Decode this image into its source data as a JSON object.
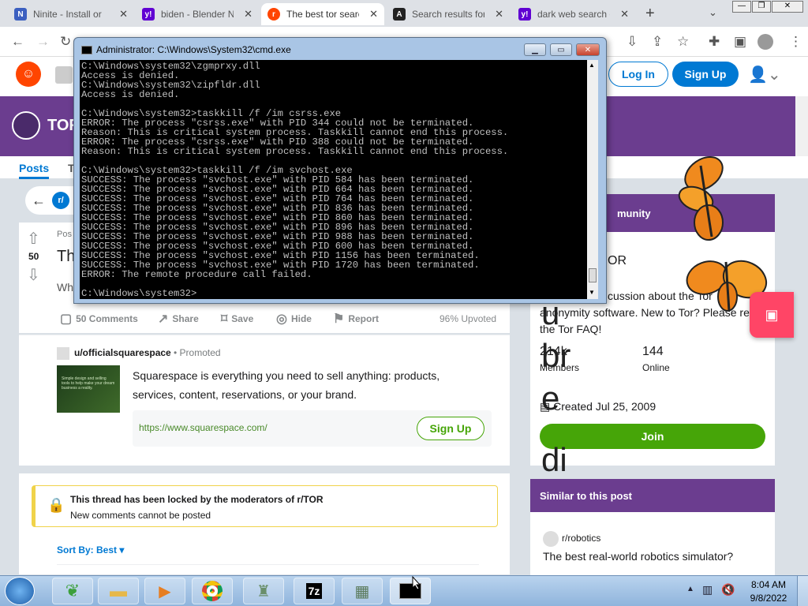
{
  "browser": {
    "tabs": [
      {
        "label": "Ninite - Install or",
        "icon": "N",
        "color": "#3b5fc0"
      },
      {
        "label": "biden - Blender N",
        "icon": "y!",
        "color": "#6001d2"
      },
      {
        "label": "The best tor searc",
        "icon": "r",
        "color": "#ff4500"
      },
      {
        "label": "Search results for",
        "icon": "A",
        "color": "#222222"
      },
      {
        "label": "dark web search e",
        "icon": "y!",
        "color": "#6001d2"
      }
    ],
    "new_tab": "+"
  },
  "reddit": {
    "login_label": "Log In",
    "signup_label": "Sign Up",
    "subreddit_short": "TOR",
    "tab_posts": "Posts",
    "tab_other": "T",
    "post": {
      "vote_count": "50",
      "posted_prefix": "Pos",
      "title_fragment": "Th",
      "body_fragment": "Wh",
      "comments": "50 Comments",
      "share": "Share",
      "save": "Save",
      "hide": "Hide",
      "report": "Report",
      "upvoted": "96% Upvoted"
    },
    "promo": {
      "user": "u/officialsquarespace",
      "tag": "Promoted",
      "text": "Squarespace is everything you need to sell anything: products, services, content, reservations, or your brand.",
      "url": "https://www.squarespace.com/",
      "cta": "Sign Up",
      "thumb_text": "Simple design and selling tools to help make your dream business a reality."
    },
    "locked": {
      "title": "This thread has been locked by the moderators of r/TOR",
      "subtitle": "New comments cannot be posted"
    },
    "sort_label": "Sort By: Best",
    "sidebar": {
      "header_fragment": "munity",
      "name_fragment": "OR",
      "about": "cussion about the Tor anonymity software. New to Tor? Please read the Tor FAQ!",
      "members_value": "214k",
      "members_label": "Members",
      "online_value": "144",
      "online_label": "Online",
      "created": "Created Jul 25, 2009",
      "join": "Join",
      "similar_title": "Similar to this post",
      "similar_sub": "r/robotics",
      "similar_post": "The best real-world robotics simulator?"
    },
    "overlay_letters": [
      "u",
      "br",
      "e",
      "di"
    ]
  },
  "cmd": {
    "title": "Administrator: C:\\Windows\\System32\\cmd.exe",
    "lines": [
      "C:\\Windows\\system32\\zgmprxy.dll",
      "Access is denied.",
      "C:\\Windows\\system32\\zipfldr.dll",
      "Access is denied.",
      "",
      "C:\\Windows\\system32>taskkill /f /im csrss.exe",
      "ERROR: The process \"csrss.exe\" with PID 344 could not be terminated.",
      "Reason: This is critical system process. Taskkill cannot end this process.",
      "ERROR: The process \"csrss.exe\" with PID 388 could not be terminated.",
      "Reason: This is critical system process. Taskkill cannot end this process.",
      "",
      "C:\\Windows\\system32>taskkill /f /im svchost.exe",
      "SUCCESS: The process \"svchost.exe\" with PID 584 has been terminated.",
      "SUCCESS: The process \"svchost.exe\" with PID 664 has been terminated.",
      "SUCCESS: The process \"svchost.exe\" with PID 764 has been terminated.",
      "SUCCESS: The process \"svchost.exe\" with PID 836 has been terminated.",
      "SUCCESS: The process \"svchost.exe\" with PID 860 has been terminated.",
      "SUCCESS: The process \"svchost.exe\" with PID 896 has been terminated.",
      "SUCCESS: The process \"svchost.exe\" with PID 988 has been terminated.",
      "SUCCESS: The process \"svchost.exe\" with PID 600 has been terminated.",
      "SUCCESS: The process \"svchost.exe\" with PID 1156 has been terminated.",
      "SUCCESS: The process \"svchost.exe\" with PID 1720 has been terminated.",
      "ERROR: The remote procedure call failed.",
      "",
      "C:\\Windows\\system32>"
    ]
  },
  "taskbar": {
    "time": "8:04 AM",
    "date": "9/8/2022"
  },
  "colors": {
    "reddit_blue": "#0079d3",
    "tor_purple": "#6b3d8f",
    "join_green": "#46a508",
    "reddit_orange": "#ff4500"
  }
}
